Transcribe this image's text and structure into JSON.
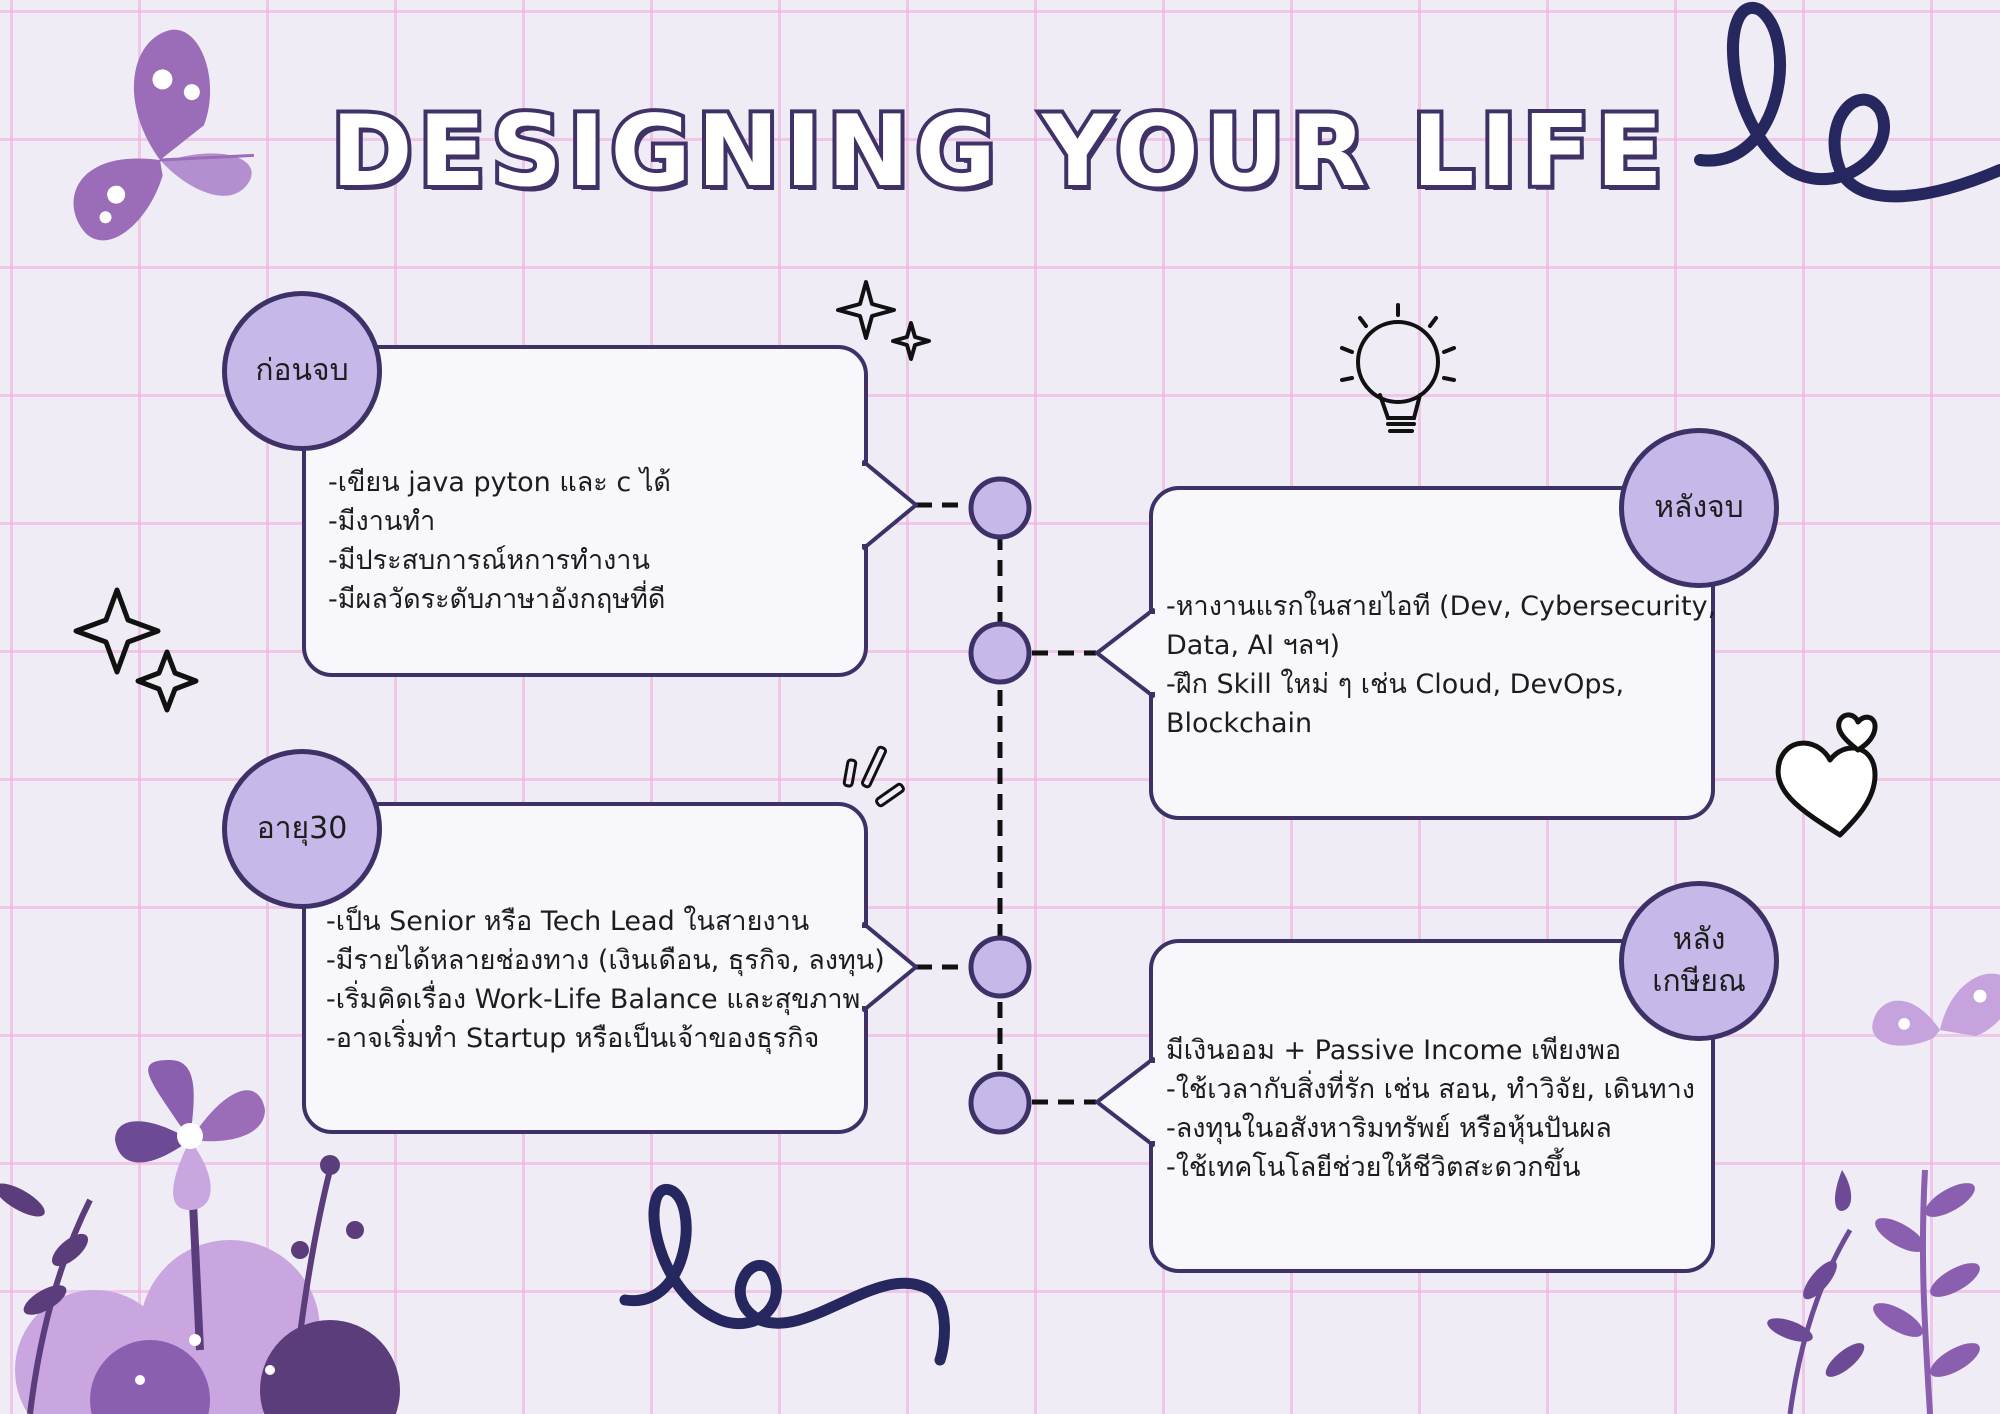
{
  "title": "DESIGNING YOUR LIFE",
  "colors": {
    "background": "#efecf6",
    "grid": "#eeaadc",
    "outline": "#3d3168",
    "badge_fill": "#c6b9ea",
    "card_fill": "#f8f7fc",
    "accent_purple": "#9b6cb8",
    "dark_purple": "#5a3d7a",
    "navy_doodle": "#26275e"
  },
  "stages": [
    {
      "label": "ก่อนจบ",
      "text": "-เขียน java pyton และ c ได้\n-มีงานทำ\n-มีประสบการณ์หการทำงาน\n-มีผลวัดระดับภาษาอังกฤษที่ดี"
    },
    {
      "label": "หลังจบ",
      "text": "-หางานแรกในสายไอที (Dev, Cybersecurity,\nData, AI ฯลฯ)\n-ฝึก Skill ใหม่ ๆ เช่น Cloud, DevOps,\nBlockchain"
    },
    {
      "label": "อายุ30",
      "text": "-เป็น Senior หรือ Tech Lead ในสายงาน\n-มีรายได้หลายช่องทาง (เงินเดือน, ธุรกิจ, ลงทุน)\n-เริ่มคิดเรื่อง Work-Life Balance และสุขภาพ\n-อาจเริ่มทำ Startup หรือเป็นเจ้าของธุรกิจ"
    },
    {
      "label": "หลัง\nเกษียณ",
      "text": "มีเงินออม + Passive Income เพียงพอ\n-ใช้เวลากับสิ่งที่รัก เช่น สอน, ทำวิจัย, เดินทาง\n-ลงทุนในอสังหาริมทรัพย์ หรือหุ้นปันผล\n-ใช้เทคโนโลยีช่วยให้ชีวิตสะดวกขึ้น"
    }
  ],
  "decorations": {
    "icons": [
      "butterfly-icon",
      "sparkle-icon",
      "lightbulb-icon",
      "heart-icon",
      "flower-icon",
      "leaf-branch-icon",
      "squiggle-icon",
      "emphasis-lines-icon"
    ]
  }
}
